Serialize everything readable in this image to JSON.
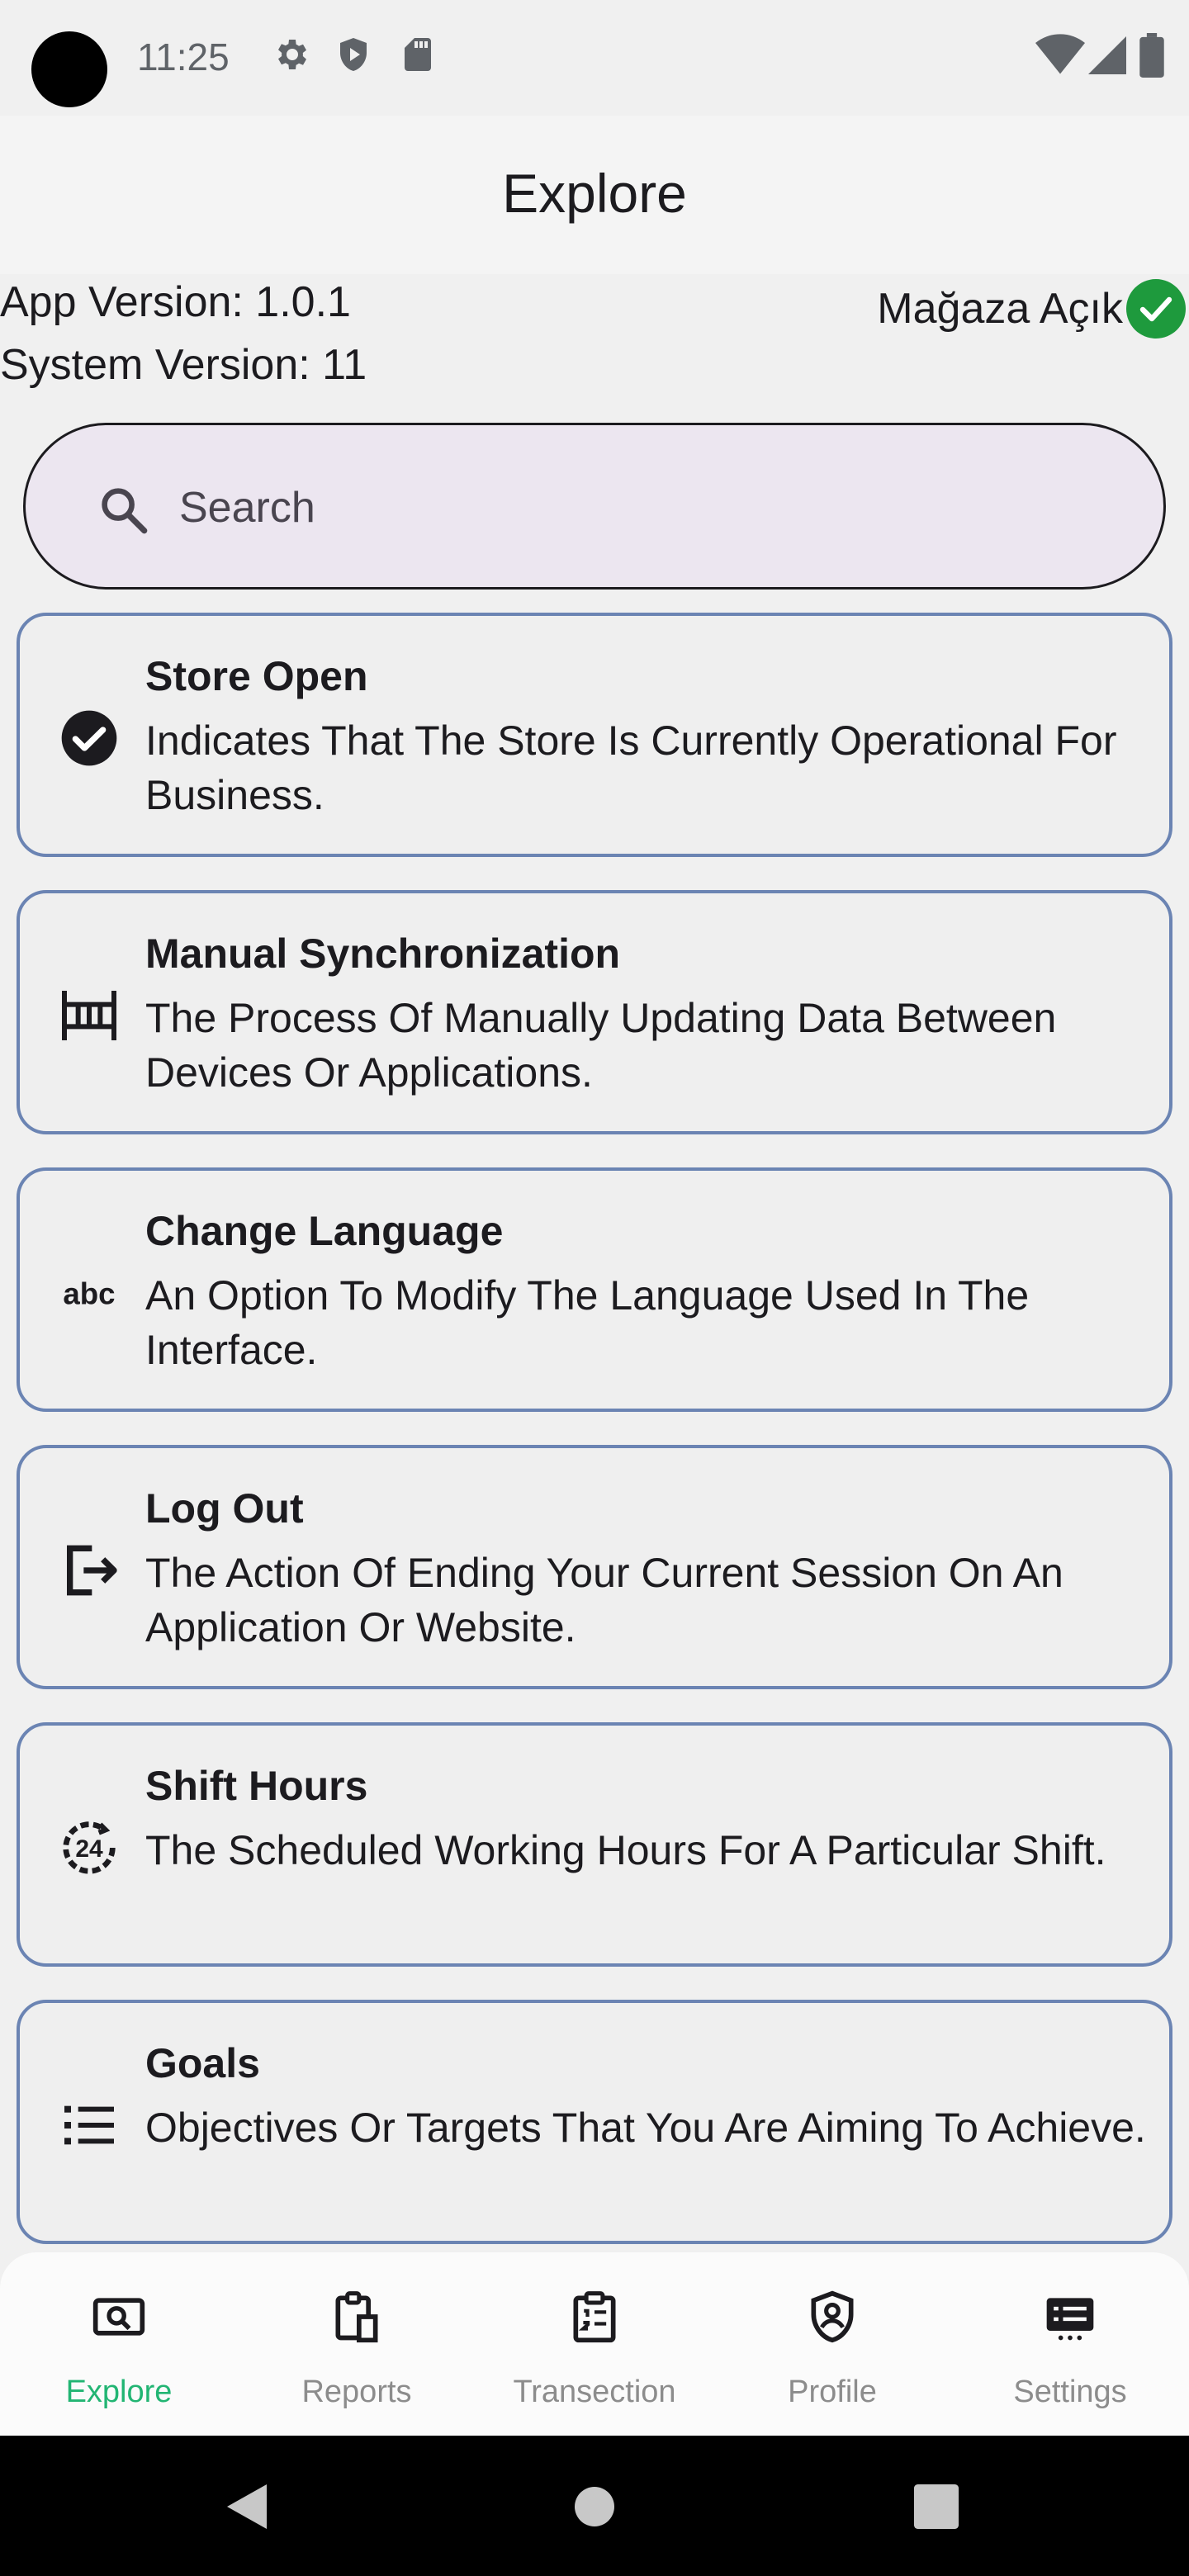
{
  "status_bar": {
    "time": "11:25",
    "icons_left": [
      "settings-icon",
      "shield-icon",
      "sd-card-icon"
    ],
    "icons_right": [
      "wifi-icon",
      "signal-icon",
      "battery-icon"
    ]
  },
  "app_bar": {
    "title": "Explore"
  },
  "info": {
    "app_version": "App Version: 1.0.1",
    "system_version": "System Version: 11",
    "store_status": "Mağaza Açık",
    "store_status_color": "#1e9a3d"
  },
  "search": {
    "placeholder": "Search",
    "value": ""
  },
  "cards": [
    {
      "icon": "check-circle-icon",
      "title": "Store Open",
      "description": "Indicates That The Store Is Currently Operational For Business."
    },
    {
      "icon": "sync-icon",
      "title": "Manual Synchronization",
      "description": "The Process Of Manually Updating Data Between Devices Or Applications."
    },
    {
      "icon": "abc-icon",
      "title": "Change Language",
      "description": "An Option To Modify The Language Used In The Interface."
    },
    {
      "icon": "logout-icon",
      "title": "Log Out",
      "description": "The Action Of Ending Your Current Session On An Application Or Website."
    },
    {
      "icon": "clock-24-icon",
      "title": "Shift Hours",
      "description": "The Scheduled Working Hours For A Particular Shift."
    },
    {
      "icon": "list-icon",
      "title": "Goals",
      "description": "Objectives Or Targets That You Are Aiming To Achieve."
    }
  ],
  "bottom_nav": {
    "active": "Explore",
    "active_color": "#22b573",
    "items": [
      {
        "label": "Explore",
        "icon": "explore-icon"
      },
      {
        "label": "Reports",
        "icon": "reports-icon"
      },
      {
        "label": "Transection",
        "icon": "transaction-icon"
      },
      {
        "label": "Profile",
        "icon": "profile-icon"
      },
      {
        "label": "Settings",
        "icon": "settings-icon"
      }
    ]
  },
  "system_nav": {
    "buttons": [
      "back-icon",
      "home-icon",
      "recents-icon"
    ]
  }
}
